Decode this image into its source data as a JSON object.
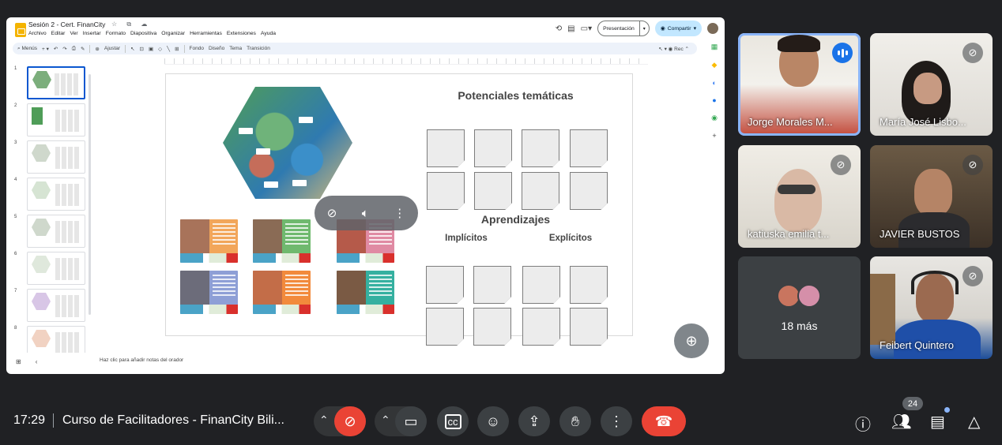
{
  "slides_app": {
    "doc_title": "Sesión 2 - Cert. FinanCity",
    "title_icons": "☆ ⧉ ☁",
    "menu": [
      "Archivo",
      "Editar",
      "Ver",
      "Insertar",
      "Formato",
      "Diapositiva",
      "Organizar",
      "Herramientas",
      "Extensiones",
      "Ayuda"
    ],
    "present_label": "Presentación",
    "share_label": "Compartir",
    "toolbar": {
      "search": "Menús",
      "zoom": "Ajustar",
      "fondo": "Fondo",
      "diseno": "Diseño",
      "tema": "Tema",
      "transicion": "Transición",
      "rec": "Rec"
    },
    "slide_numbers": [
      "1",
      "2",
      "3",
      "4",
      "5",
      "6",
      "7",
      "8"
    ],
    "slide": {
      "potenciales": "Potenciales temáticas",
      "aprendizajes": "Aprendizajes",
      "implicitos": "Implícitos",
      "explicitos": "Explícitos"
    },
    "notes_placeholder": "Haz clic para añadir notas del orador"
  },
  "participants": [
    {
      "name": "Jorge Morales M...",
      "speaking": true
    },
    {
      "name": "María José Lisbo...",
      "muted": true
    },
    {
      "name": "katiuska emilia t...",
      "muted": true
    },
    {
      "name": "JAVIER BUSTOS",
      "muted": true
    },
    {
      "name": "18 más"
    },
    {
      "name": "Feibert Quintero",
      "muted": true
    }
  ],
  "bottom_bar": {
    "time": "17:29",
    "meeting_title": "Curso de Facilitadores - FinanCity Bili...",
    "participants_count": "24"
  },
  "colors": {
    "end_call": "#ea4335",
    "accent": "#8ab4f8",
    "background": "#202124"
  }
}
